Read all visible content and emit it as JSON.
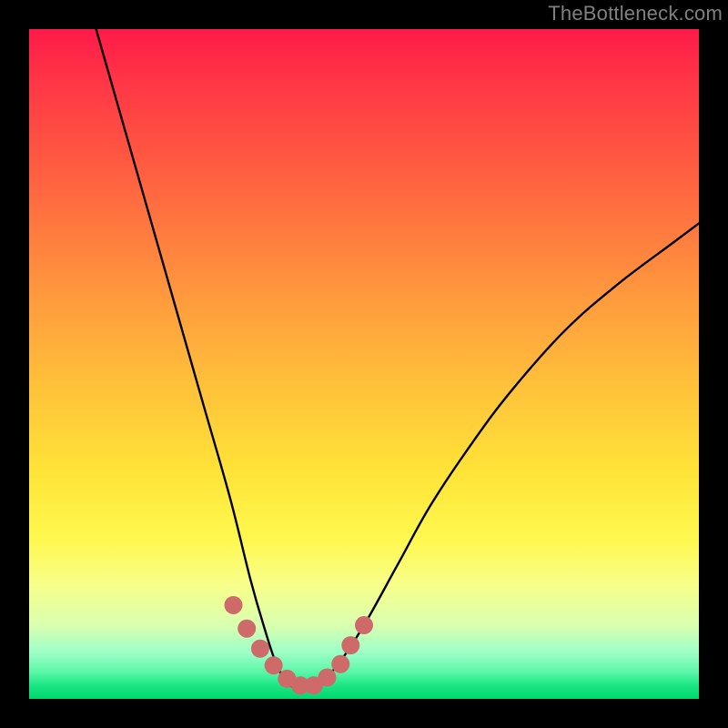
{
  "watermark": "TheBottleneck.com",
  "colors": {
    "page_bg": "#000000",
    "gradient_top": "#ff1a49",
    "gradient_bottom": "#00d86e",
    "curve_stroke": "#000000",
    "marker_fill": "#cf6a6a",
    "watermark": "#808080"
  },
  "chart_data": {
    "type": "line",
    "title": "",
    "xlabel": "",
    "ylabel": "",
    "xlim": [
      0,
      100
    ],
    "ylim": [
      0,
      100
    ],
    "series": [
      {
        "name": "bottleneck-curve",
        "x": [
          10,
          14,
          18,
          22,
          26,
          30,
          33,
          35,
          37,
          39,
          41,
          43,
          46,
          50,
          55,
          60,
          66,
          72,
          80,
          88,
          96,
          100
        ],
        "y": [
          100,
          86,
          72,
          58,
          44,
          30,
          18,
          11,
          5,
          2,
          2,
          2,
          5,
          11,
          20,
          29,
          38,
          46,
          55,
          62,
          68,
          71
        ]
      }
    ],
    "markers": {
      "name": "highlight-dots",
      "x": [
        30.5,
        32.5,
        34.5,
        36.5,
        38.5,
        40.5,
        42.5,
        44.5,
        46.5,
        48.0,
        50.0
      ],
      "y": [
        14.0,
        10.5,
        7.5,
        5.0,
        3.0,
        2.0,
        2.0,
        3.2,
        5.2,
        8.0,
        11.0
      ]
    }
  }
}
